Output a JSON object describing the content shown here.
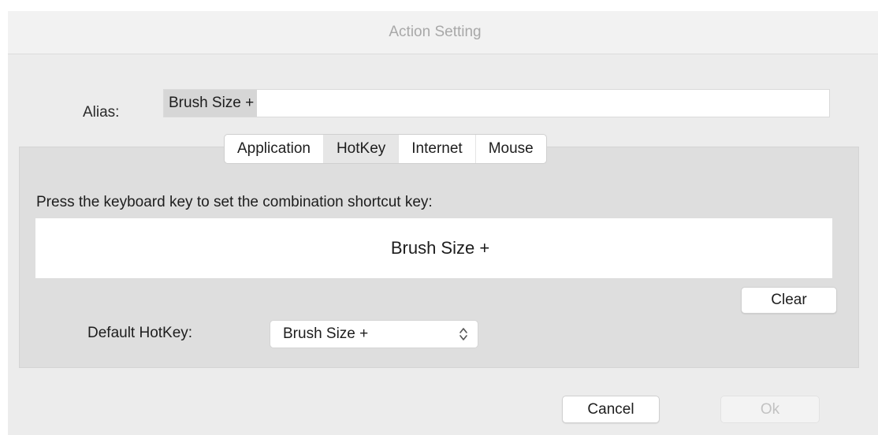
{
  "window": {
    "title": "Action Setting"
  },
  "alias": {
    "label": "Alias:",
    "value": "Brush Size +"
  },
  "tabs": [
    {
      "label": "Application",
      "selected": false
    },
    {
      "label": "HotKey",
      "selected": true
    },
    {
      "label": "Internet",
      "selected": false
    },
    {
      "label": "Mouse",
      "selected": false
    }
  ],
  "hotkey_panel": {
    "instruction": "Press the keyboard key to set the combination shortcut key:",
    "shortcut_display": "Brush Size +",
    "clear_label": "Clear",
    "default_label": "Default HotKey:",
    "default_value": "Brush Size +"
  },
  "footer": {
    "cancel_label": "Cancel",
    "ok_label": "Ok",
    "ok_enabled": false
  },
  "icons": {
    "select_arrows": "chevron-up-down-icon"
  },
  "colors": {
    "window_bg": "#ececec",
    "panel_bg": "#dedede",
    "selection_highlight": "#d6d6d6",
    "disabled_text": "#c2c2c2"
  }
}
